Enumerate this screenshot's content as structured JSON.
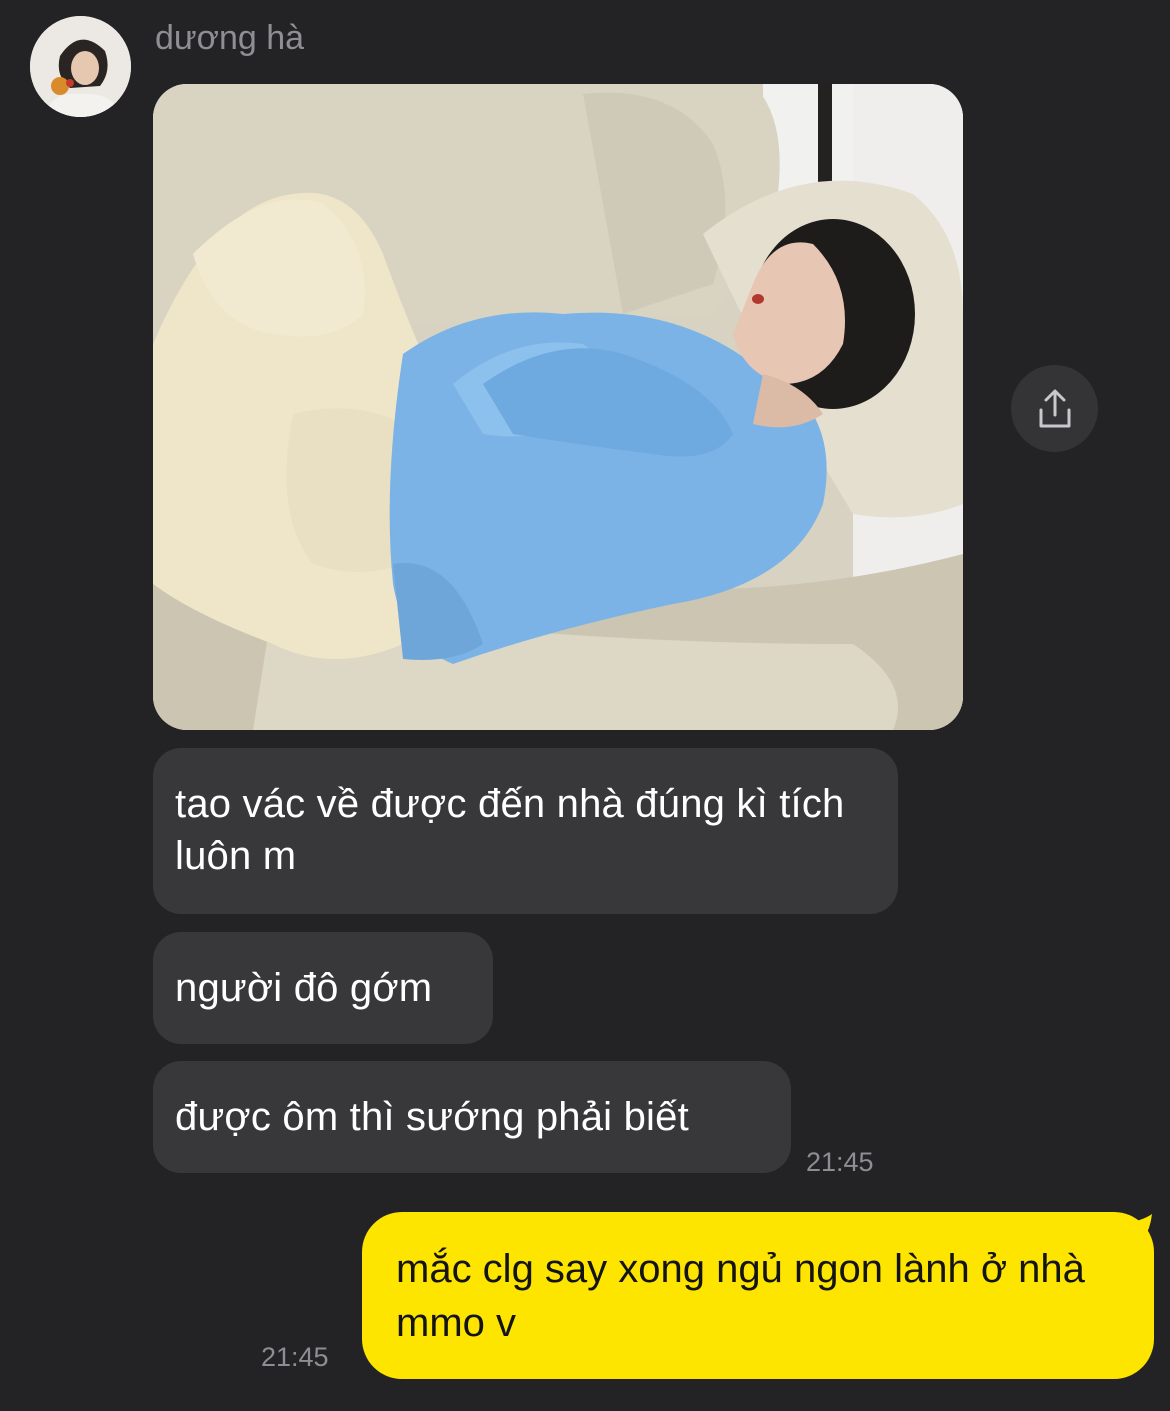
{
  "chat": {
    "sender_name": "dương hà",
    "incoming": [
      {
        "text": "tao vác về được đến nhà đúng kì tích luôn m"
      },
      {
        "text": "người đô gớm"
      },
      {
        "text": "được ôm thì sướng phải biết"
      }
    ],
    "incoming_time": "21:45",
    "outgoing": {
      "text": "mắc clg say xong ngủ ngon lành ở nhà mmo v"
    },
    "outgoing_time": "21:45"
  },
  "icons": {
    "share": "share-icon",
    "avatar": "avatar"
  },
  "colors": {
    "background": "#232325",
    "incoming_bubble": "#38383b",
    "outgoing_bubble": "#fde500",
    "timestamp": "#8e8e92"
  }
}
